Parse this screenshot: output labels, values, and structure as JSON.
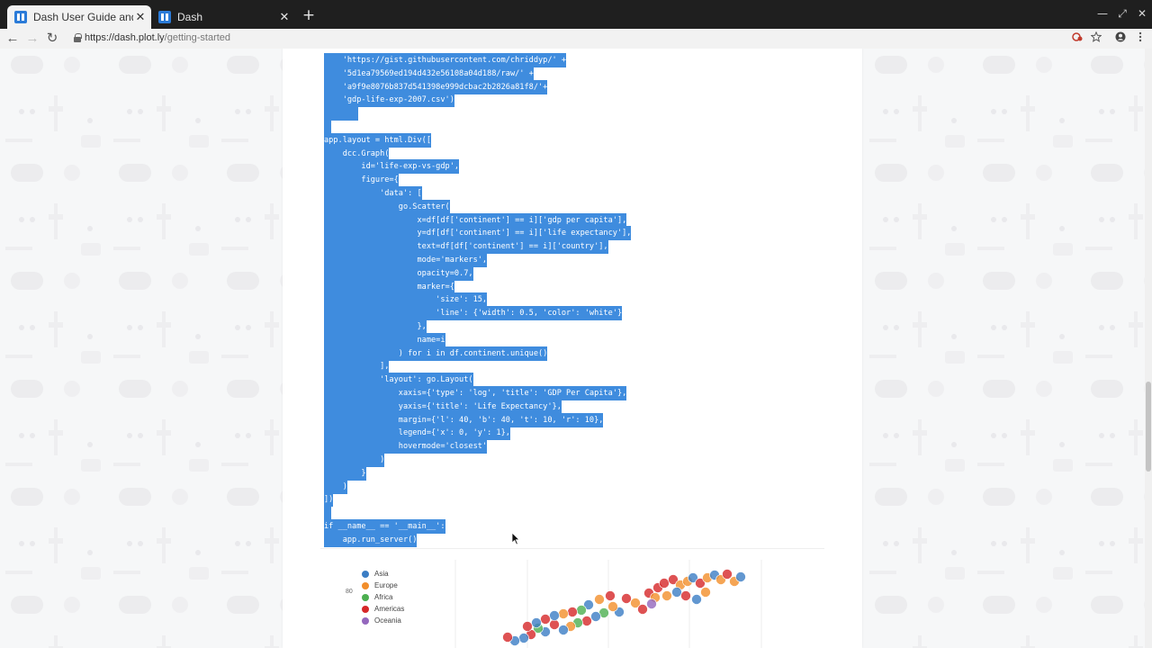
{
  "browser": {
    "tabs": [
      {
        "title": "Dash User Guide and Docume",
        "close": "✕"
      },
      {
        "title": "Dash",
        "close": "✕"
      }
    ],
    "new_tab": "+",
    "window_controls": {
      "minimize": "—",
      "maximize": "⤢",
      "close": "✕"
    },
    "url_host": "https://dash.plot.ly",
    "url_path": "/getting-started",
    "nav": {
      "back": "←",
      "forward": "→",
      "reload": "↻"
    },
    "toolbar_icons": [
      "extension-icon",
      "star-icon",
      "account-icon",
      "menu-icon"
    ]
  },
  "code": {
    "lines": [
      "    'https://gist.githubusercontent.com/chriddyp/' +",
      "    '5d1ea79569ed194d432e56108a04d188/raw/' +",
      "    'a9f9e8076b837d541398e999dcbac2b2826a81f8/'+",
      "    'gdp-life-exp-2007.csv')",
      "",
      "",
      "app.layout = html.Div([",
      "    dcc.Graph(",
      "        id='life-exp-vs-gdp',",
      "        figure={",
      "            'data': [",
      "                go.Scatter(",
      "                    x=df[df['continent'] == i]['gdp per capita'],",
      "                    y=df[df['continent'] == i]['life expectancy'],",
      "                    text=df[df['continent'] == i]['country'],",
      "                    mode='markers',",
      "                    opacity=0.7,",
      "                    marker={",
      "                        'size': 15,",
      "                        'line': {'width': 0.5, 'color': 'white'}",
      "                    },",
      "                    name=i",
      "                ) for i in df.continent.unique()",
      "            ],",
      "            'layout': go.Layout(",
      "                xaxis={'type': 'log', 'title': 'GDP Per Capita'},",
      "                yaxis={'title': 'Life Expectancy'},",
      "                margin={'l': 40, 'b': 40, 't': 10, 'r': 10},",
      "                legend={'x': 0, 'y': 1},",
      "                hovermode='closest'",
      "            )",
      "        }",
      "    )",
      "])",
      "",
      "if __name__ == '__main__':",
      "    app.run_server()"
    ]
  },
  "chart": {
    "legend": [
      {
        "name": "Asia",
        "color": "#3b7dc4"
      },
      {
        "name": "Europe",
        "color": "#f28e2b"
      },
      {
        "name": "Africa",
        "color": "#4caf50"
      },
      {
        "name": "Americas",
        "color": "#d62728"
      },
      {
        "name": "Oceania",
        "color": "#9467bd"
      }
    ],
    "ytick": "80"
  }
}
